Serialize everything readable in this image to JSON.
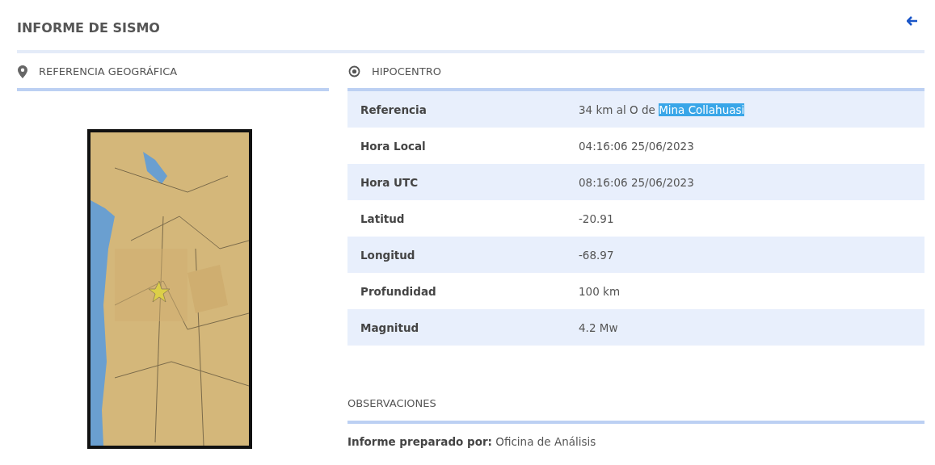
{
  "title": "INFORME DE SISMO",
  "geo_section": {
    "heading": "REFERENCIA GEOGRÁFICA"
  },
  "hypocenter": {
    "heading": "HIPOCENTRO",
    "rows": [
      {
        "label": "Referencia",
        "value": "34 km al O de ",
        "selection": "Mina Collahuasi"
      },
      {
        "label": "Hora Local",
        "value": "04:16:06 25/06/2023"
      },
      {
        "label": "Hora UTC",
        "value": "08:16:06 25/06/2023"
      },
      {
        "label": "Latitud",
        "value": "-20.91"
      },
      {
        "label": "Longitud",
        "value": "-68.97"
      },
      {
        "label": "Profundidad",
        "value": "100 km"
      },
      {
        "label": "Magnitud",
        "value": "4.2 Mw"
      }
    ]
  },
  "observations": {
    "heading": "OBSERVACIONES",
    "text": "**Informe preparado por:** Oficina de Análisis"
  }
}
